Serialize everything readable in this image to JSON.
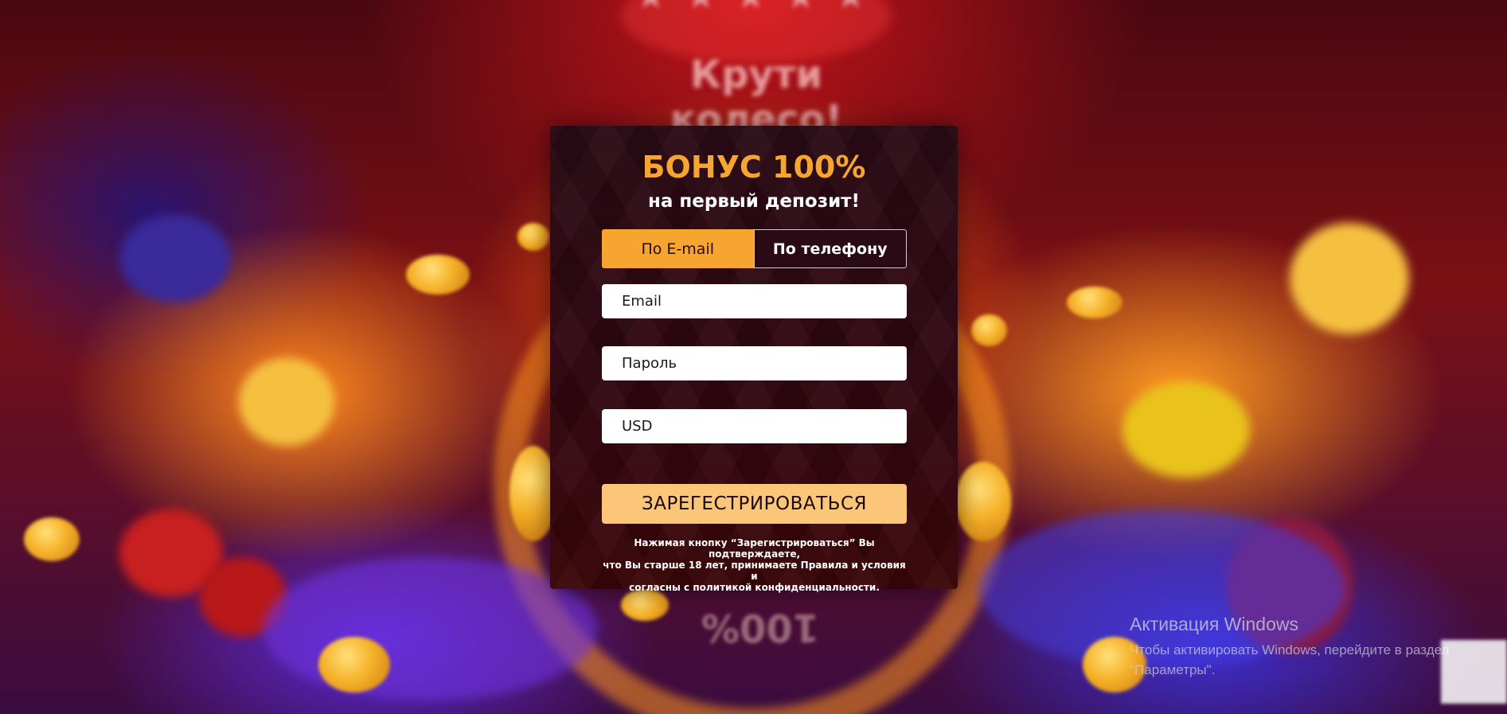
{
  "background": {
    "title": "Крути колесо!",
    "wheel_text": "100%"
  },
  "panel": {
    "title": "БОНУС 100%",
    "subtitle": "на первый депозит!",
    "tabs": [
      {
        "label": "По E-mail",
        "active": true
      },
      {
        "label": "По телефону",
        "active": false
      }
    ],
    "fields": {
      "email_placeholder": "Email",
      "password_placeholder": "Пароль",
      "currency_value": "USD"
    },
    "submit_label": "ЗАРЕГЕСТРИРОВАТЬСЯ",
    "disclaimer_line1": "Нажимая кнопку “Зарегистрироваться” Вы подтверждаете,",
    "disclaimer_line2": "что Вы старше 18 лет, принимаете Правила и условия и",
    "disclaimer_line3": "согласны с политикой конфиденциальности."
  },
  "windows_watermark": {
    "title": "Активация Windows",
    "line1": "Чтобы активировать Windows, перейдите в раздел",
    "line2": "\"Параметры\"."
  },
  "colors": {
    "accent": "#f6a530",
    "button": "#fcc67a",
    "panel_bg": "#2a0a14"
  }
}
